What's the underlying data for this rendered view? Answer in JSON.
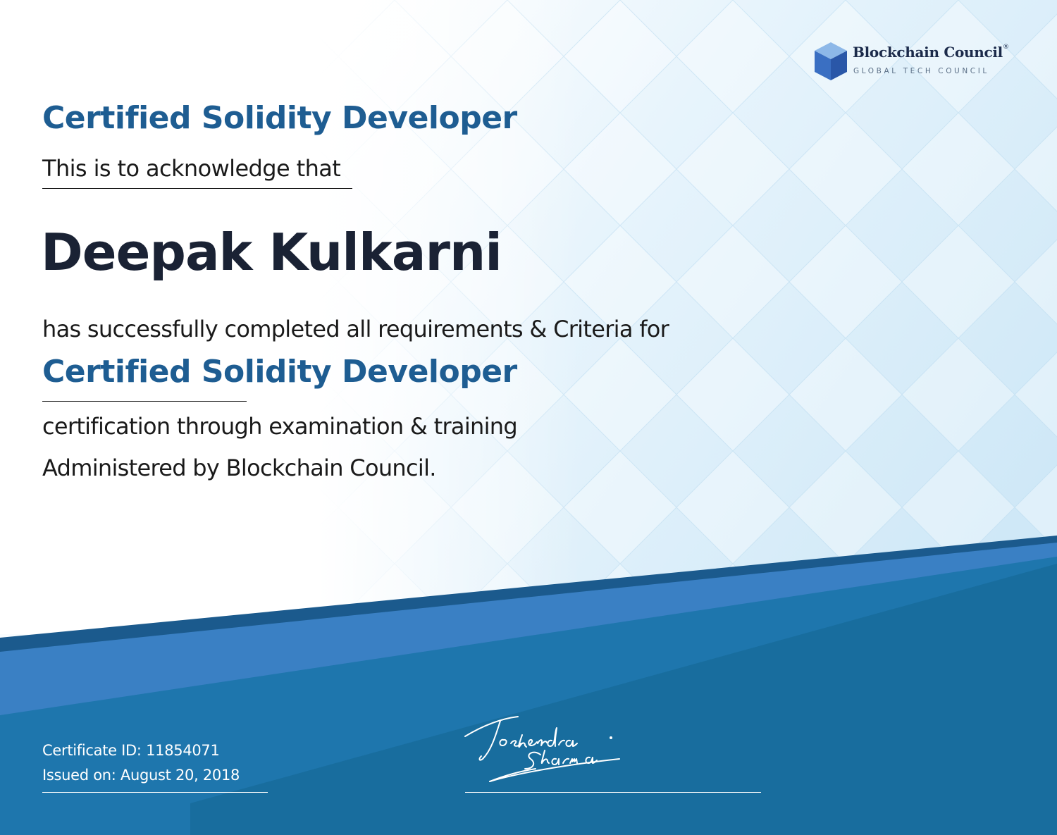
{
  "colors": {
    "title_blue": "#1e5d92",
    "band_dark": "#1a6a9c",
    "band_light": "#3a80c4",
    "text_dark": "#1a1a1a",
    "background_tint": "#d6ecf9"
  },
  "logo": {
    "icon": "cube-logo-icon",
    "title": "Blockchain Council",
    "registered_mark": "®",
    "subtitle": "GLOBAL TECH COUNCIL"
  },
  "certificate": {
    "heading": "Certified Solidity Developer",
    "acknowledge_text": "This is to acknowledge that",
    "recipient_name": "Deepak Kulkarni",
    "completed_text": "has successfully completed all requirements & Criteria for",
    "certification_name": "Certified Solidity Developer",
    "through_text": "certification through examination & training",
    "administered_text": "Administered by Blockchain Council."
  },
  "footer": {
    "certificate_id": "Certificate ID: 11854071",
    "issued_on": "Issued on: August 20, 2018",
    "signature_text": "Toshendra Sharma"
  }
}
